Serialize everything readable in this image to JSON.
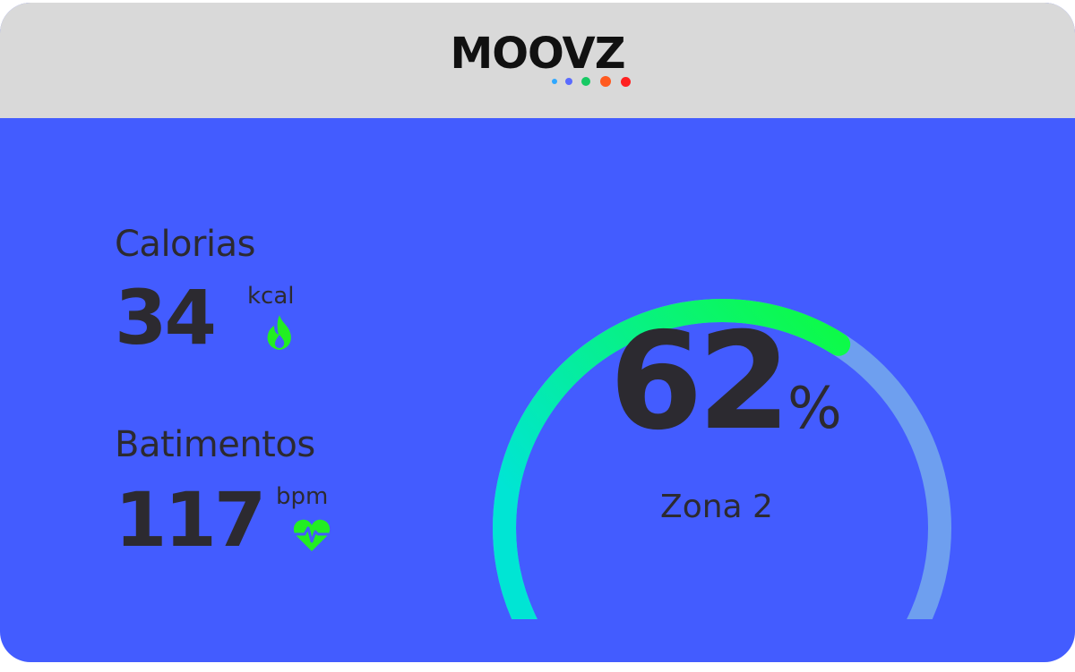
{
  "header": {
    "logo_text": "MOOVZ",
    "logo_dots": [
      "#2FA8FF",
      "#5A6BFF",
      "#17C964",
      "#FF5A1F",
      "#FF2020"
    ]
  },
  "calories": {
    "label": "Calorias",
    "value": "34",
    "unit": "kcal",
    "icon": "flame-icon"
  },
  "heart_rate": {
    "label": "Batimentos",
    "value": "117",
    "unit": "bpm",
    "icon": "heart-pulse-icon"
  },
  "gauge": {
    "percent_value": "62",
    "percent_symbol": "%",
    "fill_fraction": 0.62,
    "zone_label": "Zona 2",
    "colors": {
      "track": "#6E9FEF",
      "fill_start": "#00E5D4",
      "fill_end": "#10FF2A",
      "accent_icon": "#22EE22",
      "background": "#435CFF",
      "header_bg": "#D9D9D9",
      "text": "#2C2A30"
    }
  }
}
